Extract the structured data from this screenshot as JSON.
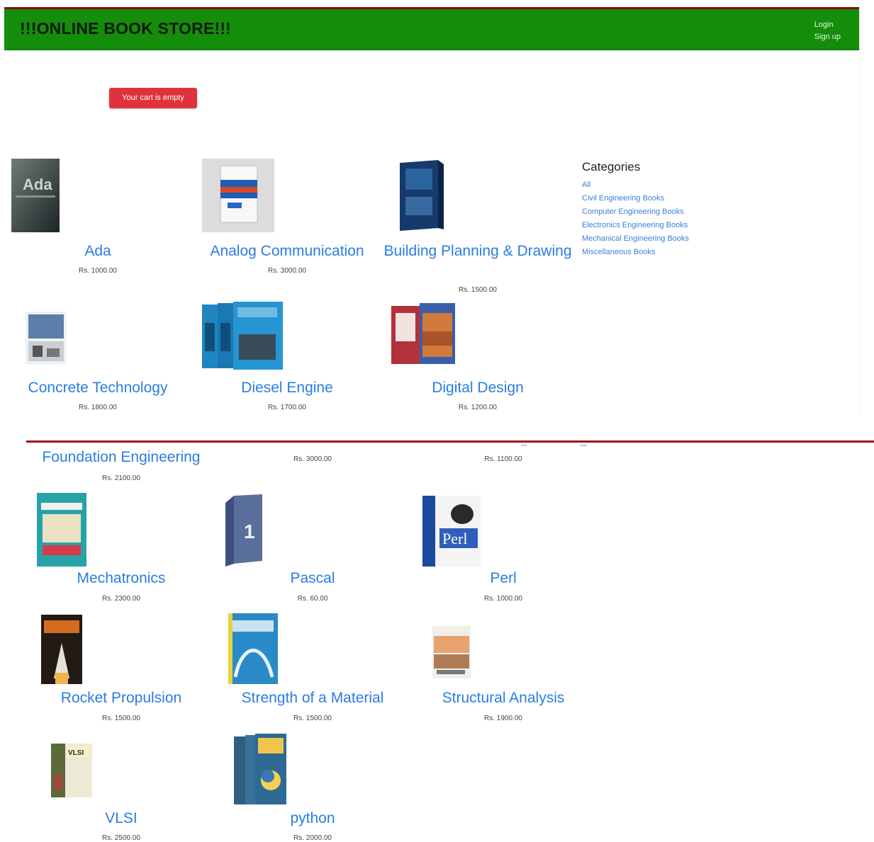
{
  "navbar": {
    "brand": "!!!ONLINE BOOK STORE!!!",
    "login": "Login",
    "signup": "Sign up"
  },
  "cart": {
    "empty_label": "Your cart is empty"
  },
  "categories": {
    "heading": "Categories",
    "items": [
      "All",
      "Civil Engineering Books",
      "Computer Engineering Books",
      "Electronics Engineering Books",
      "Mechanical Engineering Books",
      "Miscellaneous Books"
    ]
  },
  "books_top": [
    {
      "title": "Ada",
      "price": "Rs. 1000.00",
      "cover_icon": "ada-cover-image"
    },
    {
      "title": "Analog Communication",
      "price": "Rs. 3000.00",
      "cover_icon": "analog-communication-cover-image"
    },
    {
      "title": "Building Planning & Drawing",
      "price": "Rs. 1500.00",
      "cover_icon": "building-planning-cover-image"
    },
    {
      "title": "Concrete Technology",
      "price": "Rs. 1800.00",
      "cover_icon": "concrete-technology-cover-image"
    },
    {
      "title": "Diesel Engine",
      "price": "Rs. 1700.00",
      "cover_icon": "diesel-engine-cover-image"
    },
    {
      "title": "Digital Design",
      "price": "Rs. 1200.00",
      "cover_icon": "digital-design-cover-image"
    }
  ],
  "books_bottom": [
    {
      "title": "Foundation Engineering",
      "price": "Rs. 2100.00"
    },
    {
      "title": "",
      "price": "Rs. 3000.00"
    },
    {
      "title": "",
      "price": "Rs. 1100.00"
    },
    {
      "title": "Mechatronics",
      "price": "Rs. 2300.00",
      "cover_icon": "mechatronics-cover-image"
    },
    {
      "title": "Pascal",
      "price": "Rs. 60.00",
      "cover_icon": "pascal-cover-image"
    },
    {
      "title": "Perl",
      "price": "Rs. 1000.00",
      "cover_icon": "perl-cover-image"
    },
    {
      "title": "Rocket Propulsion",
      "price": "Rs. 1500.00",
      "cover_icon": "rocket-propulsion-cover-image"
    },
    {
      "title": "Strength of a Material",
      "price": "Rs. 1500.00",
      "cover_icon": "strength-of-material-cover-image"
    },
    {
      "title": "Structural Analysis",
      "price": "Rs. 1900.00",
      "cover_icon": "structural-analysis-cover-image"
    },
    {
      "title": "VLSI",
      "price": "Rs. 2500.00",
      "cover_icon": "vlsi-cover-image"
    },
    {
      "title": "python",
      "price": "Rs. 2000.00",
      "cover_icon": "python-cover-image"
    }
  ],
  "colors": {
    "navbar_bg": "#148d0b",
    "accent_link": "#2a7de1",
    "cart_badge": "#e0323d",
    "divider": "#a50e0e"
  }
}
